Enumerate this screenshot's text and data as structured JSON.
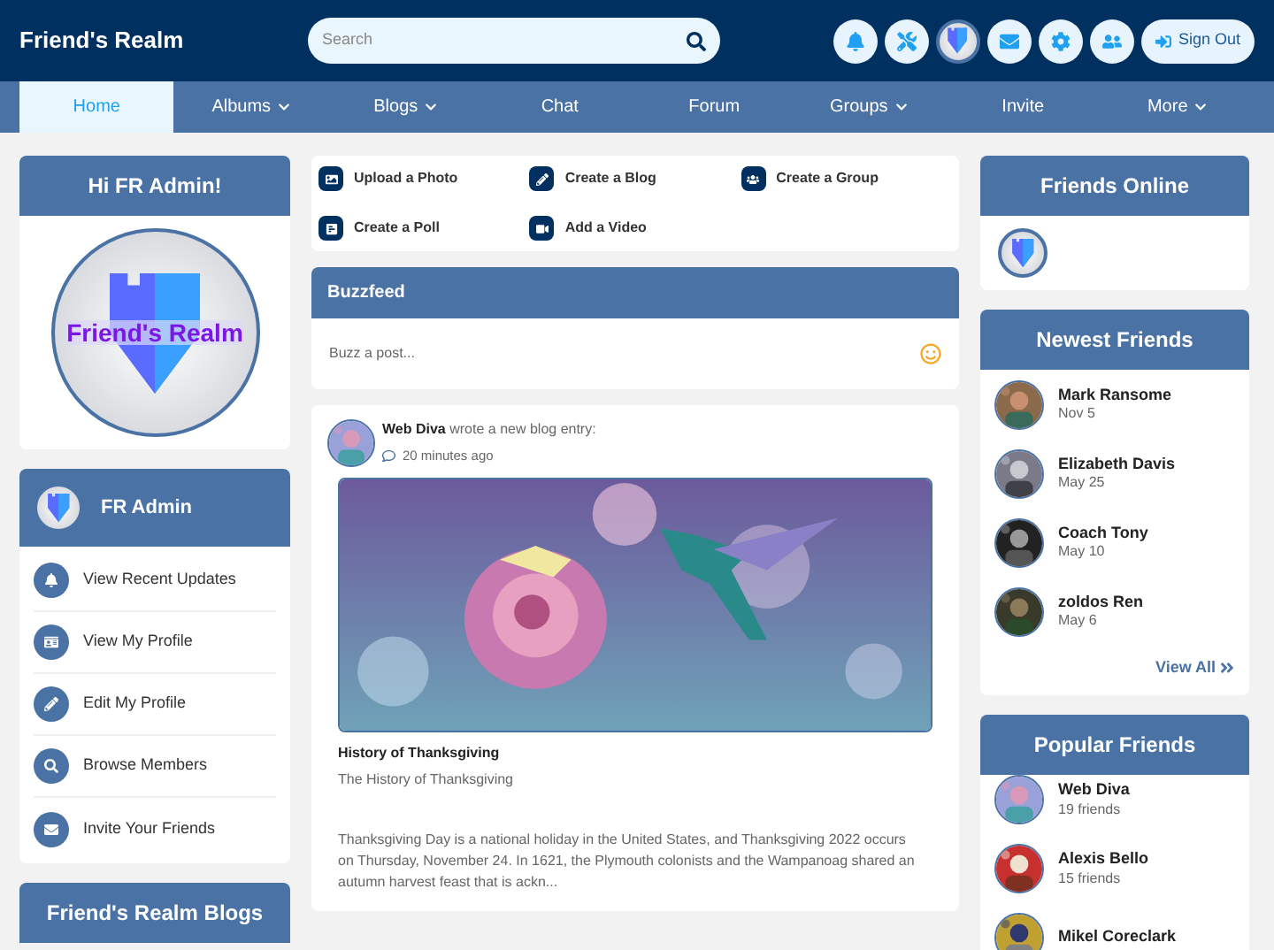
{
  "header": {
    "site_title": "Friend's Realm",
    "search": {
      "placeholder": "Search"
    },
    "sign_out": "Sign Out"
  },
  "nav": [
    {
      "label": "Home",
      "selected": true,
      "dropdown": false
    },
    {
      "label": "Albums",
      "selected": false,
      "dropdown": true
    },
    {
      "label": "Blogs",
      "selected": false,
      "dropdown": true
    },
    {
      "label": "Chat",
      "selected": false,
      "dropdown": false
    },
    {
      "label": "Forum",
      "selected": false,
      "dropdown": false
    },
    {
      "label": "Groups",
      "selected": false,
      "dropdown": true
    },
    {
      "label": "Invite",
      "selected": false,
      "dropdown": false
    },
    {
      "label": "More",
      "selected": false,
      "dropdown": true
    }
  ],
  "welcome": {
    "title": "Hi FR Admin!",
    "logo_text": "Friend's Realm"
  },
  "profile": {
    "name": "FR Admin",
    "links": [
      {
        "kind": "bell",
        "label": "View Recent Updates"
      },
      {
        "kind": "card",
        "label": "View My Profile"
      },
      {
        "kind": "pencil",
        "label": "Edit My Profile"
      },
      {
        "kind": "search",
        "label": "Browse Members"
      },
      {
        "kind": "mail",
        "label": "Invite Your Friends"
      }
    ]
  },
  "blogs_panel": {
    "title": "Friend's Realm Blogs"
  },
  "actions": [
    {
      "label": "Upload a Photo"
    },
    {
      "kind": "pencil",
      "label": "Create a Blog"
    },
    {
      "kind": "group",
      "label": "Create a Group"
    },
    {
      "kind": "poll",
      "label": "Create a Poll"
    },
    {
      "kind": "video",
      "label": "Add a Video"
    }
  ],
  "buzzfeed": {
    "title": "Buzzfeed",
    "placeholder": "Buzz a post..."
  },
  "post": {
    "author": "Web Diva",
    "action": "wrote a new blog entry:",
    "time": "20 minutes ago",
    "title": "History of Thanksgiving",
    "subtitle": "The History of Thanksgiving",
    "excerpt": "Thanksgiving Day is a national holiday in the United States, and Thanksgiving 2022 occurs on Thursday, November 24. In 1621, the Plymouth colonists and the Wampanoag shared an autumn harvest feast that is ackn..."
  },
  "friends_online": {
    "title": "Friends Online"
  },
  "newest_friends": {
    "title": "Newest Friends",
    "view_all": "View All",
    "items": [
      {
        "name": "Mark Ransome",
        "detail": "Nov 5"
      },
      {
        "name": "Elizabeth Davis",
        "detail": "May 25"
      },
      {
        "name": "Coach Tony",
        "detail": "May 10"
      },
      {
        "name": "zoldos Ren",
        "detail": "May 6"
      }
    ]
  },
  "popular_friends": {
    "title": "Popular Friends",
    "items": [
      {
        "name": "Web Diva",
        "detail": "19 friends"
      },
      {
        "name": "Alexis Bello",
        "detail": "15 friends"
      },
      {
        "name": "Mikel Coreclark"
      }
    ]
  }
}
